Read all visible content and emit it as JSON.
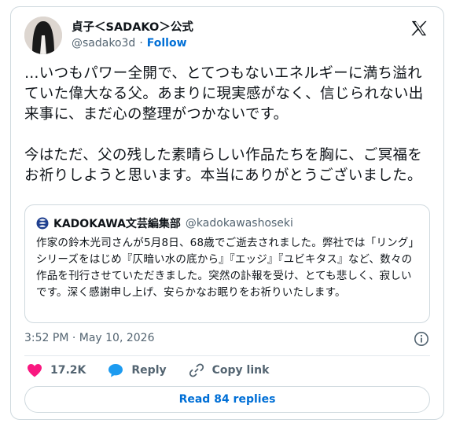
{
  "author": {
    "display_name": "貞子＜SADAKO＞公式",
    "handle": "@sadako3d",
    "separator": "·",
    "follow_label": "Follow"
  },
  "tweet": {
    "text": "…いつもパワー全開で、とてつもないエネルギーに満ち溢れていた偉大なる父。あまりに現実感がなく、信じられない出来事に、まだ心の整理がつかないです。\n\n今はただ、父の残した素晴らしい作品たちを胸に、ご冥福をお祈りしようと思います。本当にありがとうございました。",
    "timestamp": "3:52 PM · May 10, 2026"
  },
  "quote": {
    "display_name": "KADOKAWA文芸編集部",
    "handle": "@kadokawashoseki",
    "text": "作家の鈴木光司さんが5月8日、68歳でご逝去されました。弊社では「リング」シリーズをはじめ『仄暗い水の底から』『エッジ』『ユビキタス』など、数々の作品を刊行させていただきました。突然の訃報を受け、とても悲しく、寂しいです。深く感謝申し上げ、安らかなお眠りをお祈りいたします。"
  },
  "actions": {
    "likes": "17.2K",
    "reply_label": "Reply",
    "copy_link_label": "Copy link"
  },
  "replies_button_label": "Read 84 replies",
  "colors": {
    "like": "#f91880",
    "link": "#006fd6",
    "muted": "#536471",
    "border": "#cfd9de"
  },
  "icons": [
    "x-logo-icon",
    "kadokawa-logo-icon",
    "info-icon",
    "heart-icon",
    "reply-bubble-icon",
    "link-icon"
  ]
}
